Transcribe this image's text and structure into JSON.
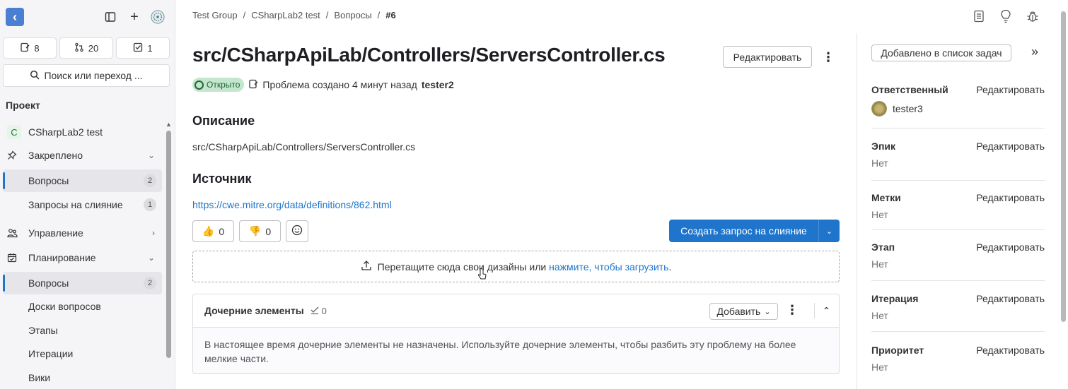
{
  "sidebar": {
    "counters": [
      {
        "icon": "issue-icon",
        "value": "8"
      },
      {
        "icon": "merge-request-icon",
        "value": "20"
      },
      {
        "icon": "todo-icon",
        "value": "1"
      }
    ],
    "search_label": "Поиск или переход ...",
    "section_title": "Проект",
    "project_name": "CSharpLab2 test",
    "project_initial": "C",
    "items": [
      {
        "label": "Закреплено"
      },
      {
        "label": "Вопросы",
        "badge": "2"
      },
      {
        "label": "Запросы на слияние",
        "badge": "1"
      },
      {
        "label": "Управление"
      },
      {
        "label": "Планирование"
      },
      {
        "label": "Вопросы",
        "badge": "2"
      },
      {
        "label": "Доски вопросов"
      },
      {
        "label": "Этапы"
      },
      {
        "label": "Итерации"
      },
      {
        "label": "Вики"
      }
    ]
  },
  "breadcrumb": [
    "Test Group",
    "CSharpLab2 test",
    "Вопросы",
    "#6"
  ],
  "issue": {
    "title": "src/CSharpApiLab/Controllers/ServersController.cs",
    "edit_label": "Редактировать",
    "status": "Открыто",
    "meta_text": "Проблема создано 4 минут назад",
    "author": "tester2",
    "description_heading": "Описание",
    "description": "src/CSharpApiLab/Controllers/ServersController.cs",
    "source_heading": "Источник",
    "source_link": "https://cwe.mitre.org/data/definitions/862.html",
    "thumbs_up": "0",
    "thumbs_down": "0",
    "create_mr_label": "Создать запрос на слияние",
    "dropzone_text": "Перетащите сюда свои дизайны или",
    "dropzone_link": "нажмите, чтобы загрузить",
    "dropzone_end": "."
  },
  "child_items": {
    "title": "Дочерние элементы",
    "count": "0",
    "add_label": "Добавить",
    "empty_text": "В настоящее время дочерние элементы не назначены. Используйте дочерние элементы, чтобы разбить эту проблему на более мелкие части."
  },
  "right_sidebar": {
    "todo_label": "Добавлено в список задач",
    "edit_label": "Редактировать",
    "assignee_label": "Ответственный",
    "assignee": "tester3",
    "blocks": [
      {
        "label": "Эпик",
        "value": "Нет"
      },
      {
        "label": "Метки",
        "value": "Нет"
      },
      {
        "label": "Этап",
        "value": "Нет"
      },
      {
        "label": "Итерация",
        "value": "Нет"
      },
      {
        "label": "Приоритет",
        "value": "Нет"
      }
    ]
  },
  "colors": {
    "accent": "#1f75cb",
    "status_bg": "#c3e6cd",
    "status_fg": "#24663b"
  }
}
